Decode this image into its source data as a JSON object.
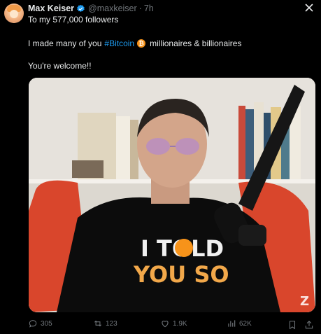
{
  "author": {
    "name": "Max Keiser",
    "handle": "@maxkeiser",
    "separator": "·",
    "time": "7h"
  },
  "tweet": {
    "line1": "To my 577,000 followers",
    "line2_prefix": "I made many of you",
    "hashtag": "#Bitcoin",
    "btc_symbol": "₿",
    "line2_suffix": "millionaires & billionaires",
    "line3": "You're welcome!!"
  },
  "media": {
    "shirt_line1": "I TOLD",
    "shirt_line2": "YOU SO",
    "watermark": "Z"
  },
  "actions": {
    "replies": "305",
    "reposts": "123",
    "likes": "1.9K",
    "views": "62K"
  },
  "colors": {
    "accent": "#1d9bf0",
    "bitcoin": "#f7931a",
    "muted": "#71767b"
  }
}
